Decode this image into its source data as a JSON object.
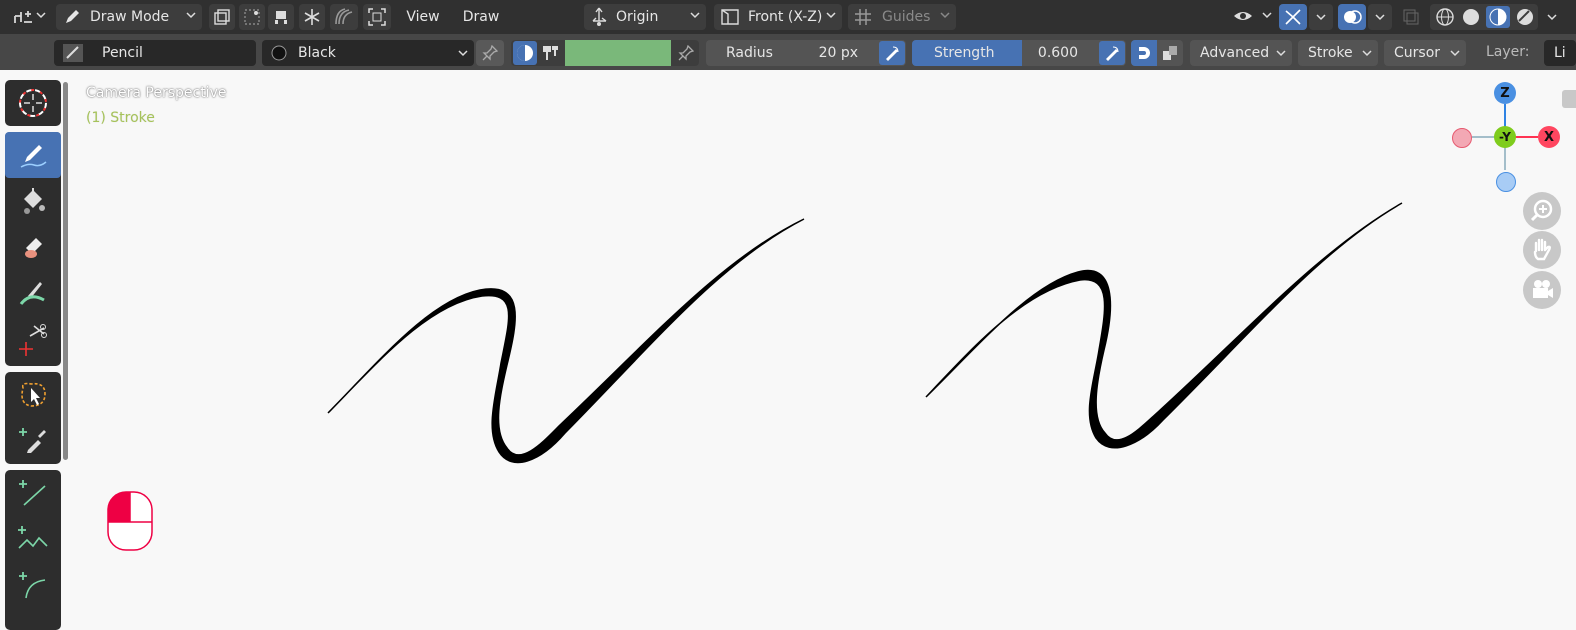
{
  "header": {
    "mode_label": "Draw Mode",
    "menu": [
      "View",
      "Draw"
    ],
    "pivot_label": "Origin",
    "view_label": "Front (X-Z)",
    "guides_label": "Guides"
  },
  "tool_settings": {
    "brush_name": "Pencil",
    "material_name": "Black",
    "color_swatch": "#7ab87a",
    "radius_label": "Radius",
    "radius_value": "20 px",
    "strength_label": "Strength",
    "strength_value": "0.600",
    "menus": [
      "Advanced",
      "Stroke",
      "Cursor"
    ],
    "layer_label": "Layer:",
    "layer_value": "Li"
  },
  "viewport": {
    "overlay_title": "Camera Perspective",
    "overlay_object": "(1) Stroke",
    "gizmo": {
      "z": "Z",
      "y": "-Y",
      "x": "X"
    }
  },
  "colors": {
    "accent": "#4772b3",
    "header_bg": "#303030",
    "toolbar_bg": "#2d2d2d",
    "overlay_object": "#a6c35a"
  },
  "toolbar": {
    "tools": [
      "cursor",
      "draw",
      "fill",
      "erase",
      "tint",
      "cutter",
      "select-lasso",
      "eyedropper",
      "line",
      "polyline",
      "arc"
    ]
  }
}
